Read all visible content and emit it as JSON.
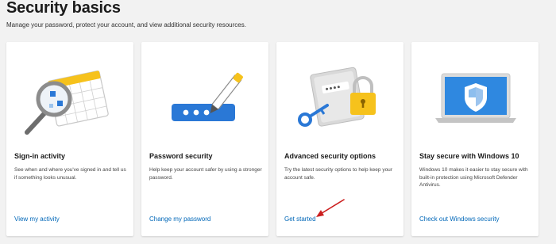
{
  "page": {
    "title": "Security basics",
    "subtitle": "Manage your password, protect your account, and view additional security resources."
  },
  "cards": [
    {
      "title": "Sign-in activity",
      "description": "See when and where you've signed in and tell us if something looks unusual.",
      "link": "View my activity",
      "icon": "calendar-magnifier-icon"
    },
    {
      "title": "Password security",
      "description": "Help keep your account safer by using a stronger password.",
      "link": "Change my password",
      "icon": "password-pen-icon"
    },
    {
      "title": "Advanced security options",
      "description": "Try the latest security options to help keep your account safe.",
      "link": "Get started",
      "icon": "lock-key-icon"
    },
    {
      "title": "Stay secure with Windows 10",
      "description": "Windows 10 makes it easier to stay secure with built-in protection using Microsoft Defender Antivirus.",
      "link": "Check out Windows security",
      "icon": "laptop-shield-icon"
    }
  ],
  "colors": {
    "link": "#0067b8",
    "accent_blue": "#2a78d6",
    "accent_yellow": "#f6c21c",
    "annotation_arrow": "#cc1f1f"
  }
}
